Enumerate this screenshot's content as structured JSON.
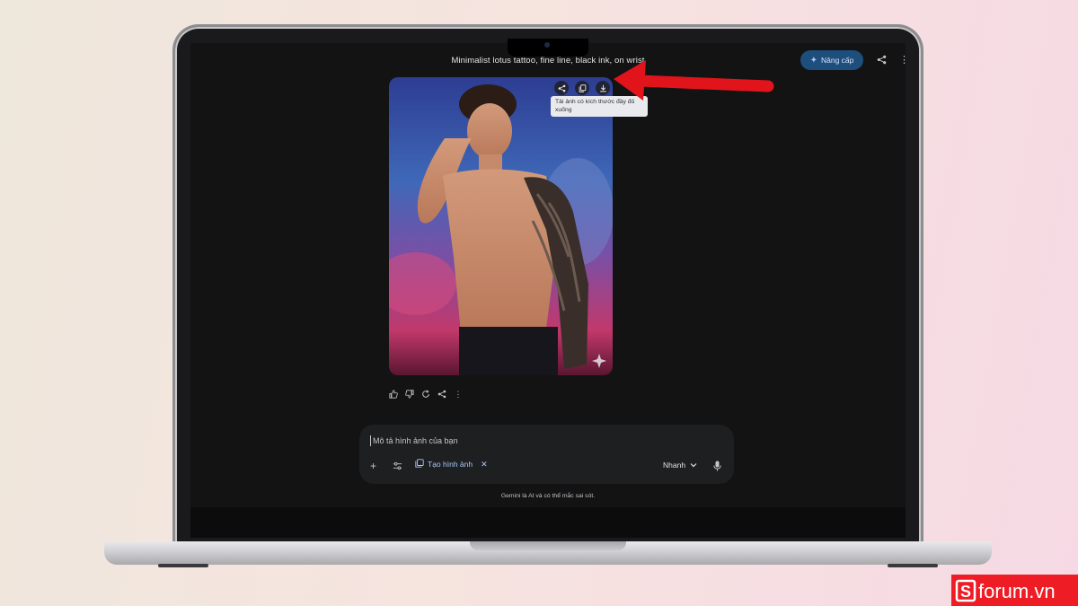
{
  "app": {
    "chat_title": "Minimalist lotus tattoo, fine line, black ink, on wrist",
    "upgrade_label": "Nâng cấp"
  },
  "image": {
    "tooltip": "Tải ảnh có kích thước đầy đủ xuống",
    "tools": [
      "share-icon",
      "copy-icon",
      "download-icon"
    ]
  },
  "response_actions": [
    "thumbs-up-icon",
    "thumbs-down-icon",
    "regenerate-icon",
    "share-icon",
    "more-vertical-icon"
  ],
  "composer": {
    "placeholder": "Mô tả hình ảnh của bạn",
    "chip_label": "Tạo hình ảnh",
    "mode_label": "Nhanh"
  },
  "disclaimer": "Gemini là AI và có thể mắc sai sót.",
  "watermark": {
    "text": "forum.vn",
    "mark": "S"
  },
  "colors": {
    "screen_bg": "#131314",
    "composer_bg": "#1e1f20",
    "accent_blue": "#a8c7fa",
    "upgrade_bg": "#1e4e7c",
    "arrow_red": "#e0141a",
    "watermark_red": "#ee1c25"
  }
}
